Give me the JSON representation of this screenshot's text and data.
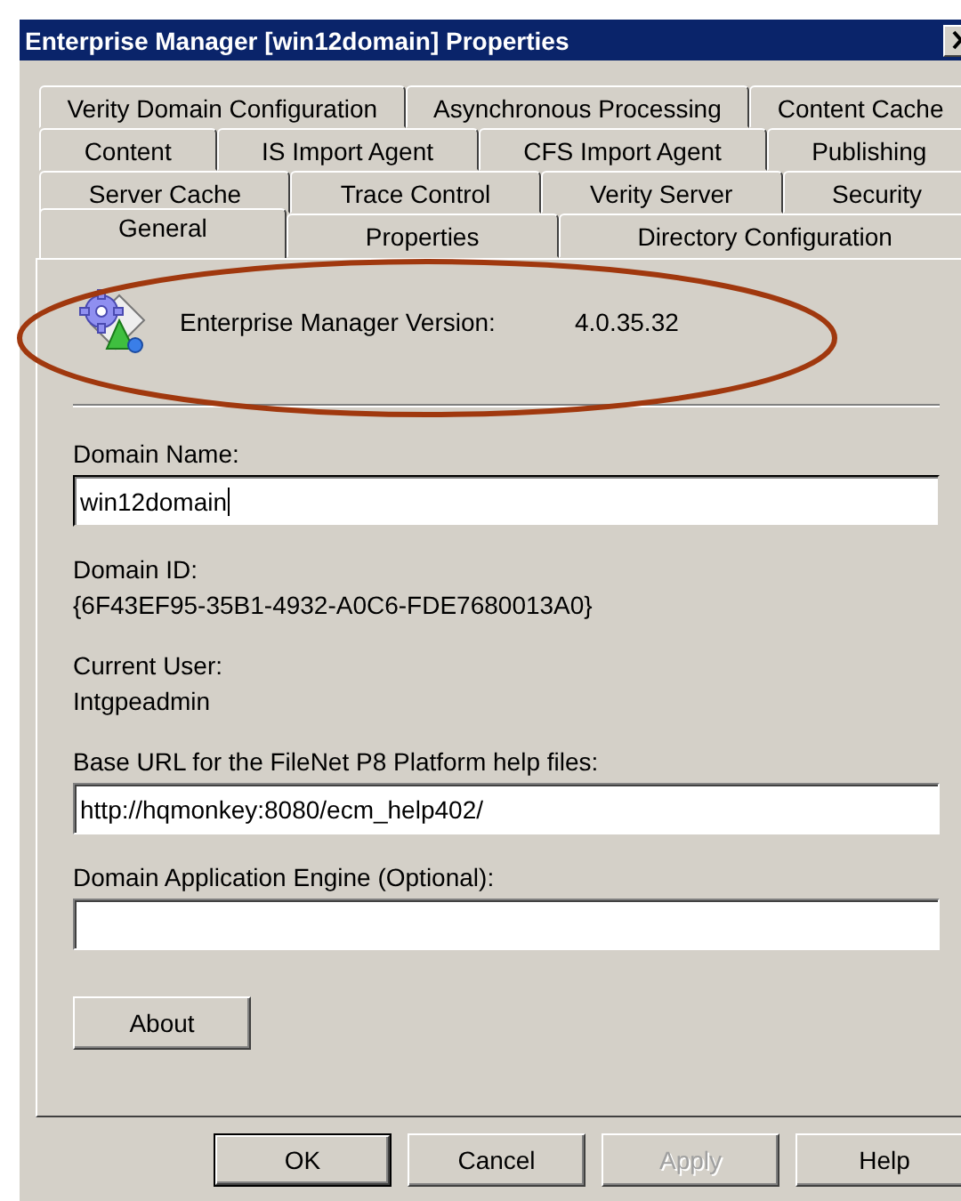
{
  "window": {
    "title": "Enterprise Manager [win12domain] Properties"
  },
  "tab_rows": [
    {
      "tabs": [
        {
          "label": "Verity Domain Configuration",
          "selected": false
        },
        {
          "label": "Asynchronous Processing",
          "selected": false
        },
        {
          "label": "Content Cache",
          "selected": false
        }
      ]
    },
    {
      "tabs": [
        {
          "label": "Content",
          "selected": false
        },
        {
          "label": "IS Import Agent",
          "selected": false
        },
        {
          "label": "CFS Import Agent",
          "selected": false
        },
        {
          "label": "Publishing",
          "selected": false
        }
      ]
    },
    {
      "tabs": [
        {
          "label": "Server Cache",
          "selected": false
        },
        {
          "label": "Trace Control",
          "selected": false
        },
        {
          "label": "Verity Server",
          "selected": false
        },
        {
          "label": "Security",
          "selected": false
        }
      ]
    },
    {
      "tabs": [
        {
          "label": "General",
          "selected": true
        },
        {
          "label": "Properties",
          "selected": false
        },
        {
          "label": "Directory Configuration",
          "selected": false
        }
      ]
    }
  ],
  "version": {
    "label": "Enterprise Manager Version:",
    "value": "4.0.35.32"
  },
  "fields": [
    {
      "kind": "input",
      "label": "Domain Name:",
      "value": "win12domain",
      "focused": true
    },
    {
      "kind": "text",
      "label": "Domain ID:",
      "value": "{6F43EF95-35B1-4932-A0C6-FDE7680013A0}"
    },
    {
      "kind": "text",
      "label": "Current User:",
      "value": "Intgpeadmin"
    },
    {
      "kind": "input",
      "label": "Base URL for the FileNet P8 Platform help files:",
      "value": "http://hqmonkey:8080/ecm_help402/",
      "focused": false
    },
    {
      "kind": "input",
      "label": "Domain Application Engine (Optional):",
      "focused": false
    }
  ],
  "about_button": "About",
  "buttons": [
    {
      "label": "OK",
      "default": true,
      "disabled": false
    },
    {
      "label": "Cancel",
      "default": false,
      "disabled": false
    },
    {
      "label": "Apply",
      "default": false,
      "disabled": true
    },
    {
      "label": "Help",
      "default": false,
      "disabled": false
    }
  ],
  "annotations": [
    {
      "kind": "ellipse",
      "color": "#a0380e"
    }
  ]
}
